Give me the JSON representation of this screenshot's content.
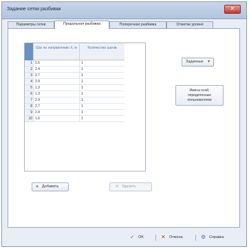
{
  "window": {
    "title": "Задание сетки разбивки",
    "close_glyph": "✕"
  },
  "tabs": [
    {
      "label": "Параметры сетки",
      "active": false
    },
    {
      "label": "Продольная разбивка",
      "active": true
    },
    {
      "label": "Поперечная разбивка",
      "active": false
    },
    {
      "label": "Отметки уровня",
      "active": false
    }
  ],
  "grid": {
    "columns": [
      "Шаг по направлению X, м",
      "Количество шагов"
    ],
    "rows": [
      {
        "num": "1",
        "step": "1.6",
        "count": "1"
      },
      {
        "num": "2",
        "step": "2.4",
        "count": "1"
      },
      {
        "num": "3",
        "step": "2.7",
        "count": "1"
      },
      {
        "num": "4",
        "step": "2.9",
        "count": "1"
      },
      {
        "num": "5",
        "step": "1.3",
        "count": "1"
      },
      {
        "num": "6",
        "step": "1.3",
        "count": "1"
      },
      {
        "num": "7",
        "step": "2.9",
        "count": "1"
      },
      {
        "num": "8",
        "step": "2.7",
        "count": "1"
      },
      {
        "num": "9",
        "step": "2.4",
        "count": "1"
      },
      {
        "num": "10",
        "step": "1.6",
        "count": "1"
      }
    ]
  },
  "mode_dropdown": {
    "value": "Заданные",
    "arrow": "▼"
  },
  "user_button": {
    "line1": "Имена осей,",
    "line2": "определенные",
    "line3": "пользователем"
  },
  "add_button": {
    "label": "Добавить",
    "icon": "+"
  },
  "delete_button": {
    "label": "Удалить",
    "icon": "✕"
  },
  "footer": {
    "ok_label": "OK",
    "ok_icon": "✓",
    "cancel_label": "Отмена",
    "cancel_icon": "✕",
    "help_label": "Справка",
    "help_icon": "⚙"
  },
  "colors": {
    "ok": "#2e8b2e",
    "cancel": "#c0392b",
    "help": "#4a6fa5",
    "grid_header_text": "#5577a6",
    "grid_corner": "#6a90c4"
  }
}
